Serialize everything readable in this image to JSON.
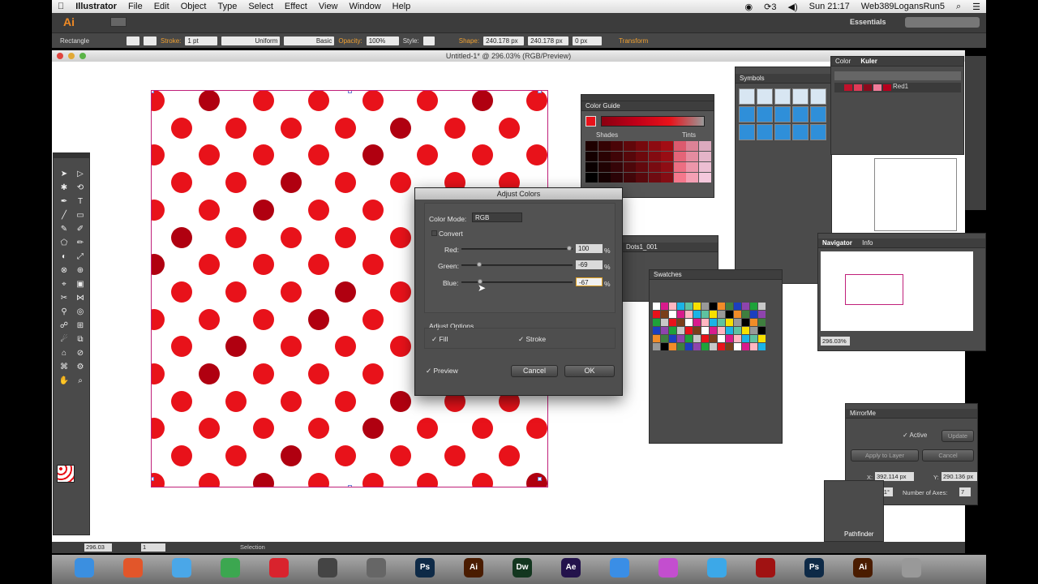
{
  "menubar": {
    "app": "Illustrator",
    "items": [
      "File",
      "Edit",
      "Object",
      "Type",
      "Select",
      "Effect",
      "View",
      "Window",
      "Help"
    ],
    "time": "Sun 21:17",
    "user": "Web389LogansRun5",
    "badge": "3"
  },
  "appbar": {
    "logo": "Ai",
    "workspace": "Essentials"
  },
  "control": {
    "object": "Rectangle",
    "stroke_label": "Stroke:",
    "stroke_weight": "1 pt",
    "profile": "Uniform",
    "brush": "Basic",
    "opacity_label": "Opacity:",
    "opacity": "100%",
    "style_label": "Style:",
    "shape_label": "Shape:",
    "w": "240.178 px",
    "h": "240.178 px",
    "corner": "0 px",
    "transform": "Transform"
  },
  "document": {
    "title": "Untitled-1* @ 296.03% (RGB/Preview)"
  },
  "dialog": {
    "title": "Adjust Colors",
    "color_mode_label": "Color Mode:",
    "color_mode": "RGB",
    "convert": "Convert",
    "red_label": "Red:",
    "red": "100",
    "green_label": "Green:",
    "green": "-69",
    "blue_label": "Blue:",
    "blue": "-67",
    "pct": "%",
    "adjust_options": "Adjust Options",
    "fill": "Fill",
    "stroke": "Stroke",
    "preview": "Preview",
    "cancel": "Cancel",
    "ok": "OK",
    "check": "✓"
  },
  "panels": {
    "color_guide": "Color Guide",
    "shades": "Shades",
    "tints": "Tints",
    "symbols": "Symbols",
    "color_tab": "Color",
    "kuler_tab": "Kuler",
    "kuler_item": "Red1",
    "swatches": "Swatches",
    "swatch_lib": "Dots1_001",
    "navigator": "Navigator",
    "info": "Info",
    "nav_zoom": "296.03%",
    "mirrorme": "MirrorMe",
    "mirror_active": "Active",
    "mirror_update": "Update",
    "mirror_apply": "Apply to Layer",
    "mirror_cancel": "Cancel",
    "mirror_x_label": "X:",
    "mirror_x": "392.114 px",
    "mirror_y_label": "Y:",
    "mirror_y": "290.136 px",
    "mirror_angle": "317.71°",
    "mirror_axes_label": "Number of Axes:",
    "mirror_axes": "7",
    "pathfinder": "Pathfinder"
  },
  "status": {
    "zoom": "296.03",
    "page": "1",
    "tool": "Selection"
  },
  "colors": {
    "dot": "#e8121a",
    "dot_dark": "#b00010",
    "artboard_stroke": "#c0207a"
  },
  "icons": [
    "apple-icon",
    "search-icon",
    "spotlight-icon",
    "finder-icon",
    "firefox-icon",
    "chrome-icon",
    "opera-icon",
    "photoshop-icon",
    "illustrator-icon",
    "dreamweaver-icon",
    "aftereffects-icon",
    "trash-icon"
  ]
}
